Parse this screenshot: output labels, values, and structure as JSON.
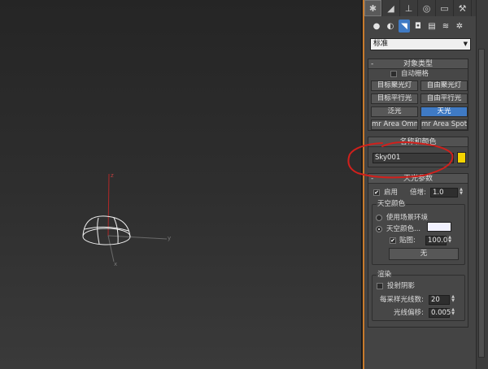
{
  "tabs": [
    {
      "icon": "create-icon",
      "glyph": "✱",
      "active": true
    },
    {
      "icon": "modify-icon",
      "glyph": "◢",
      "active": false
    },
    {
      "icon": "hierarchy-icon",
      "glyph": "⊥",
      "active": false
    },
    {
      "icon": "motion-icon",
      "glyph": "◎",
      "active": false
    },
    {
      "icon": "display-icon",
      "glyph": "▭",
      "active": false
    },
    {
      "icon": "utilities-icon",
      "glyph": "⚒",
      "active": false
    }
  ],
  "subicons": [
    {
      "icon": "geometry-icon",
      "glyph": "●",
      "active": false
    },
    {
      "icon": "shapes-icon",
      "glyph": "◐",
      "active": false
    },
    {
      "icon": "lights-icon",
      "glyph": "◥",
      "active": true
    },
    {
      "icon": "cameras-icon",
      "glyph": "◘",
      "active": false
    },
    {
      "icon": "helpers-icon",
      "glyph": "▤",
      "active": false
    },
    {
      "icon": "spacewarps-icon",
      "glyph": "≋",
      "active": false
    },
    {
      "icon": "systems-icon",
      "glyph": "✲",
      "active": false
    }
  ],
  "category_dropdown": {
    "value": "标准"
  },
  "object_type": {
    "title": "对象类型",
    "toggle": "-",
    "autogrid_label": "自动栅格",
    "buttons": [
      "目标聚光灯",
      "自由聚光灯",
      "目标平行光",
      "自由平行光",
      "泛光",
      "天光",
      "mr Area Omni",
      "mr Area Spot"
    ],
    "selected_index": 5
  },
  "name_color": {
    "title": "名称和颜色",
    "name_value": "Sky001",
    "swatch_color": "#f5d400"
  },
  "skylight_params": {
    "title": "天光参数",
    "toggle": "-",
    "enabled_label": "启用",
    "enabled_checked": "✔",
    "multiplier_label": "倍增:",
    "multiplier_value": "1.0",
    "sky_color": {
      "title": "天空颜色",
      "use_scene_env": "使用场景环境",
      "sky_color_label": "天空颜色...",
      "swatch_color": "#f2f2ff",
      "map_label": "贴图:",
      "map_checked": "✔",
      "map_amount": "100.0",
      "map_button": "无"
    },
    "render": {
      "title": "渲染",
      "cast_shadows": "投射阴影",
      "rays_label": "每采样光线数:",
      "rays_value": "20",
      "ray_bias_label": "光线偏移:",
      "ray_bias_value": "0.005"
    }
  },
  "viewport": {
    "axis_z": "z",
    "axis_y": "y",
    "axis_x": "x"
  },
  "colors": {
    "accent_blue": "#3f7ac4",
    "annotation_red": "#d0201c",
    "viewport_bg": "#2a2a2a",
    "panel_bg": "#444444"
  }
}
